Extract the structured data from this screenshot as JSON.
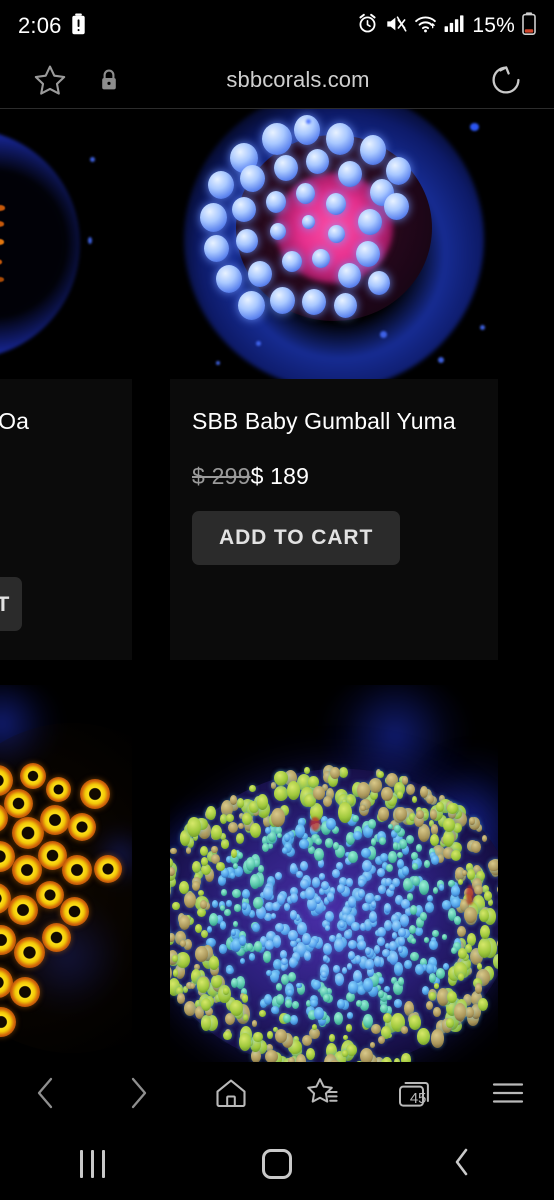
{
  "status_bar": {
    "time": "2:06",
    "battery_percent": "15%",
    "icons": [
      "battery-alert-icon",
      "alarm-icon",
      "mute-vibrate-icon",
      "wifi-icon",
      "cellular-signal-icon",
      "battery-icon"
    ]
  },
  "browser": {
    "url": "sbbcorals.com",
    "icons": {
      "bookmark_star": "star-outline-icon",
      "security": "lock-icon",
      "reload": "reload-icon"
    },
    "bottom_nav": {
      "back": "back-chevron-icon",
      "forward": "forward-chevron-icon",
      "home": "home-icon",
      "bookmarks": "bookmarks-star-icon",
      "tabs_label": "45",
      "menu": "hamburger-menu-icon"
    }
  },
  "system_nav": {
    "recents": "recents-icon",
    "home": "home-square-icon",
    "back": "back-chevron-icon"
  },
  "page": {
    "products": [
      {
        "id": "left-partial-top",
        "title": "ZOa",
        "image_alt": "orange-zoanthid-coral-photo",
        "button_label": "ADD TO CART",
        "clipped": true
      },
      {
        "id": "baby-gumball-yuma",
        "title": "SBB Baby Gumball Yuma",
        "price_old": "$ 299",
        "price_new": "$ 189",
        "image_alt": "blue-pink-yuma-coral-photo",
        "button_label": "ADD TO CART",
        "clipped": false
      },
      {
        "id": "left-partial-bottom",
        "image_alt": "orange-yellow-zoanthid-colony-photo",
        "clipped": true
      },
      {
        "id": "right-bottom",
        "image_alt": "green-blue-rhodactis-coral-photo",
        "clipped": false
      }
    ]
  },
  "colors": {
    "background": "#000000",
    "card_background": "#0b0b0b",
    "button_background": "#2b2b2b",
    "button_text": "#e2e2e2",
    "title_text": "#ffffff",
    "price_old_text": "#9a9a9a",
    "url_text": "#cfcfcf",
    "icon_stroke": "#b9b9b9",
    "battery_low": "#d0452b"
  }
}
